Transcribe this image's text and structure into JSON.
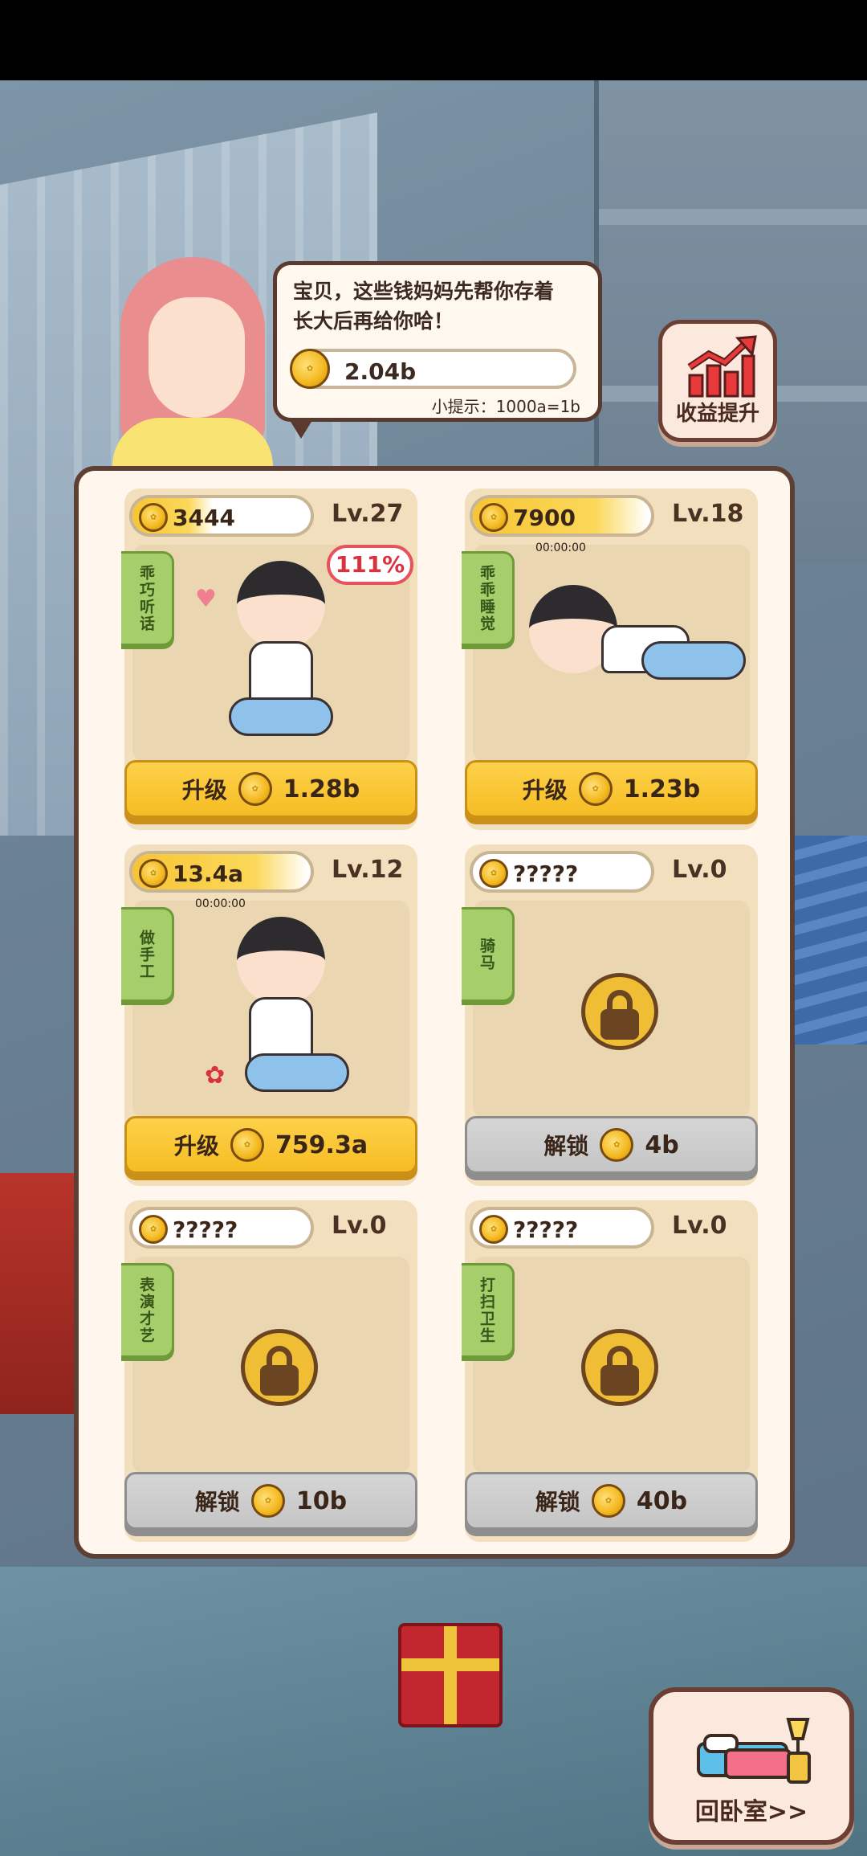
{
  "bubble": {
    "line1": "宝贝，这些钱妈妈先帮你存着",
    "line2": "长大后再给你哈！",
    "balance": "2.04b",
    "tip": "小提示：1000a=1b"
  },
  "income_button": {
    "label": "收益提升"
  },
  "cards": [
    {
      "coin_value": "3444",
      "level": "Lv.27",
      "progress": 0.45,
      "tag": "乖巧听话",
      "percent": "111%",
      "timer": "",
      "button_label": "升级",
      "button_cost": "1.28b",
      "locked": false
    },
    {
      "coin_value": "7900",
      "level": "Lv.18",
      "progress": 0.98,
      "tag": "乖乖睡觉",
      "percent": "",
      "timer": "00:00:00",
      "button_label": "升级",
      "button_cost": "1.23b",
      "locked": false
    },
    {
      "coin_value": "13.4a",
      "level": "Lv.12",
      "progress": 0.98,
      "tag": "做手工",
      "percent": "",
      "timer": "00:00:00",
      "button_label": "升级",
      "button_cost": "759.3a",
      "locked": false
    },
    {
      "coin_value": "?????",
      "level": "Lv.0",
      "progress": 0,
      "tag": "骑马",
      "percent": "",
      "timer": "",
      "button_label": "解锁",
      "button_cost": "4b",
      "locked": true
    },
    {
      "coin_value": "?????",
      "level": "Lv.0",
      "progress": 0,
      "tag": "表演才艺",
      "percent": "",
      "timer": "",
      "button_label": "解锁",
      "button_cost": "10b",
      "locked": true
    },
    {
      "coin_value": "?????",
      "level": "Lv.0",
      "progress": 0,
      "tag": "打扫卫生",
      "percent": "",
      "timer": "",
      "button_label": "解锁",
      "button_cost": "40b",
      "locked": true
    }
  ],
  "bedroom_button": {
    "label": "回卧室>>"
  },
  "colors": {
    "accent_yellow": "#f6bd23",
    "tag_green": "#a6cf6b",
    "panel_border": "#5e3f33",
    "percent_red": "#e8525c"
  },
  "icons": [
    "coin-icon",
    "lock-icon",
    "chart-up-icon",
    "bed-icon"
  ]
}
